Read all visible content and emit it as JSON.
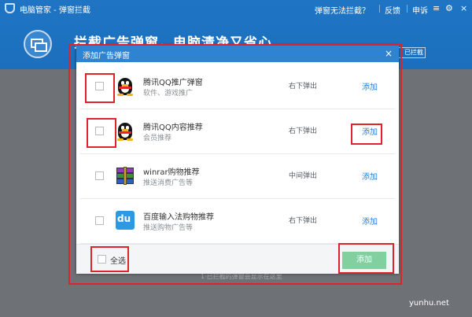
{
  "app": {
    "title": "电脑管家 - 弹窗拦截",
    "links": {
      "cant_intercept": "弹窗无法拦截？",
      "feedback": "反馈",
      "report": "申诉"
    },
    "banner_title": "拦截广告弹窗，电脑清净又省心",
    "intercepted_btn": "已拦截"
  },
  "bottom_hint": "1·已拦截的弹窗会显示在这里",
  "dialog": {
    "title": "添加广告弹窗",
    "close": "×",
    "rows": [
      {
        "name": "腾讯QQ推广弹窗",
        "desc": "软件、游戏推广",
        "position": "右下弹出",
        "action": "添加",
        "icon": "qq-penguin-icon"
      },
      {
        "name": "腾讯QQ内容推荐",
        "desc": "会员推荐",
        "position": "右下弹出",
        "action": "添加",
        "icon": "qq-penguin-icon"
      },
      {
        "name": "winrar购物推荐",
        "desc": "推送消费广告等",
        "position": "中间弹出",
        "action": "添加",
        "icon": "winrar-icon"
      },
      {
        "name": "百度输入法购物推荐",
        "desc": "推送购物广告等",
        "position": "右下弹出",
        "action": "添加",
        "icon": "baidu-du-icon"
      }
    ],
    "select_all": "全选",
    "add_button": "添加"
  },
  "watermark": "yunhu.net",
  "colors": {
    "header_blue": "#1f75c4",
    "dialog_header": "#2f83d3",
    "link_blue": "#2a7fd4",
    "add_button_green": "#82cfa0",
    "highlight_red": "#e0232a"
  }
}
